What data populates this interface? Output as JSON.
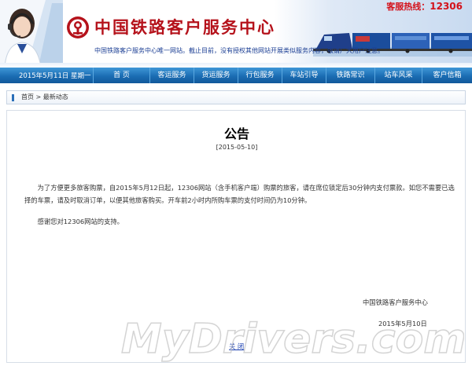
{
  "header": {
    "site_title": "中国铁路客户服务中心",
    "hotline_label": "客服热线：",
    "hotline_number": "12306",
    "notice_strip": "中国铁路客户服务中心唯一网站。截止目前，没有授权其他网站开展类似服务内容，敬请广大用户注意。"
  },
  "nav": {
    "date": "2015年5月11日 星期一",
    "items": [
      "首 页",
      "客运服务",
      "货运服务",
      "行包服务",
      "车站引导",
      "铁路常识",
      "站车风采",
      "客户信箱"
    ]
  },
  "breadcrumb": {
    "home": "首页",
    "separator": " > ",
    "current": "最新动态"
  },
  "notice": {
    "title": "公告",
    "date": "[2015-05-10]",
    "para1": "为了方便更多旅客购票，自2015年5月12日起，12306网站（含手机客户端）购票的旅客，请在席位锁定后30分钟内支付票款。如您不需要已选择的车票，请及时取消订单，以便其他旅客购买。开车前2小时内所购车票的支付时间仍为10分钟。",
    "para2": "感谢您对12306网站的支持。",
    "signature": "中国铁路客户服务中心",
    "sign_date": "2015年5月10日",
    "close_label": "关  闭"
  },
  "watermark": "MyDrivers.com",
  "colors": {
    "title_red": "#b5121b",
    "nav_blue": "#1b6db3",
    "link_blue": "#1a3fb0"
  }
}
